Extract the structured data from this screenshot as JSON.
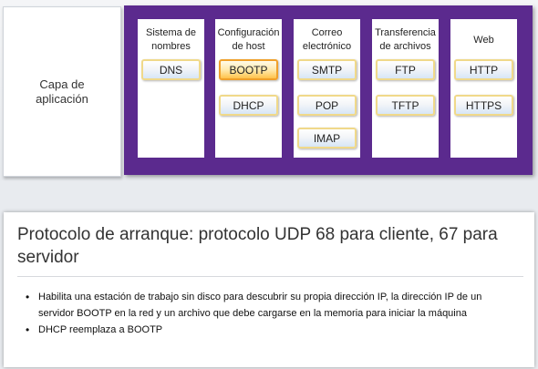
{
  "app_layer": {
    "label": "Capa de\naplicación"
  },
  "columns": [
    {
      "title": "Sistema de\nnombres",
      "protocols": [
        "DNS"
      ]
    },
    {
      "title": "Configuración\nde host",
      "protocols": [
        "BOOTP",
        "DHCP"
      ],
      "selected": "BOOTP"
    },
    {
      "title": "Correo\nelectrónico",
      "protocols": [
        "SMTP",
        "POP",
        "IMAP"
      ]
    },
    {
      "title": "Transferencia\nde archivos",
      "protocols": [
        "FTP",
        "TFTP"
      ]
    },
    {
      "title": "Web",
      "protocols": [
        "HTTP",
        "HTTPS"
      ]
    }
  ],
  "info": {
    "title": "Protocolo de arranque: protocolo UDP 68 para cliente, 67 para servidor",
    "bullets": [
      "Habilita una estación de trabajo sin disco para descubrir su propia dirección IP, la dirección IP de un servidor BOOTP en la red y un archivo que debe cargarse en la memoria para iniciar la máquina",
      "DHCP reemplaza a BOOTP"
    ]
  },
  "colors": {
    "panel": "#5b2a8e",
    "button_border": "#f0d98a",
    "selected_fill": "#ffc24a"
  }
}
